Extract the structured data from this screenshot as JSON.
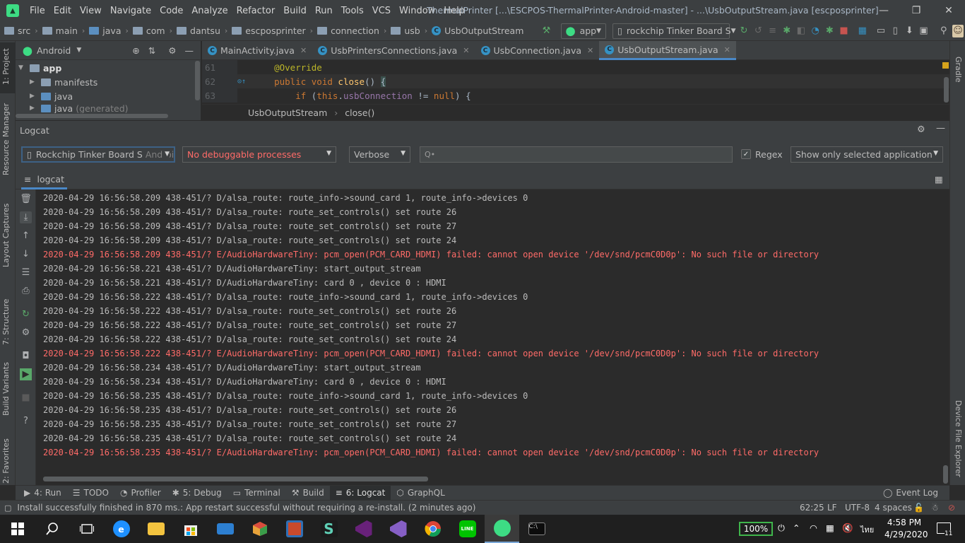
{
  "window": {
    "title": "ThermalPrinter [...\\ESCPOS-ThermalPrinter-Android-master] - ...\\UsbOutputStream.java [escposprinter]",
    "menu": [
      "File",
      "Edit",
      "View",
      "Navigate",
      "Code",
      "Analyze",
      "Refactor",
      "Build",
      "Run",
      "Tools",
      "VCS",
      "Window",
      "Help"
    ]
  },
  "navbar": {
    "breadcrumbs": [
      "src",
      "main",
      "java",
      "com",
      "dantsu",
      "escposprinter",
      "connection",
      "usb",
      "UsbOutputStream"
    ],
    "run_config": "app",
    "device": "rockchip Tinker Board S"
  },
  "left_strip": [
    "1: Project",
    "Resource Manager",
    "Layout Captures",
    "7: Structure",
    "Build Variants",
    "2: Favorites"
  ],
  "right_strip": [
    "Gradle",
    "Device File Explorer"
  ],
  "project": {
    "view_mode": "Android",
    "tree": [
      {
        "label": "app",
        "level": 0,
        "expanded": true
      },
      {
        "label": "manifests",
        "level": 1,
        "expanded": false
      },
      {
        "label": "java",
        "level": 1,
        "expanded": false
      },
      {
        "label": "java",
        "suffix": "(generated)",
        "level": 1,
        "expanded": false
      }
    ]
  },
  "editor": {
    "tabs": [
      {
        "label": "MainActivity.java",
        "active": false
      },
      {
        "label": "UsbPrintersConnections.java",
        "active": false
      },
      {
        "label": "UsbConnection.java",
        "active": false
      },
      {
        "label": "UsbOutputStream.java",
        "active": true
      }
    ],
    "lines": [
      {
        "num": "61",
        "code": "    @Override"
      },
      {
        "num": "62",
        "code": "    public void close() {"
      },
      {
        "num": "63",
        "code": "        if (this.usbConnection != null) {"
      }
    ],
    "crumbs": [
      "UsbOutputStream",
      "close()"
    ]
  },
  "logcat": {
    "title": "Logcat",
    "device": "Rockchip Tinker Board S",
    "device_suffix": "Android",
    "process": "No debuggable processes",
    "level": "Verbose",
    "search_placeholder": "Q•",
    "regex_label": "Regex",
    "regex_checked": true,
    "filter": "Show only selected application",
    "tab_label": "logcat",
    "lines": [
      {
        "text": "2020-04-29 16:56:58.209 438-451/? D/alsa_route: route_info->sound_card 1, route_info->devices 0",
        "level": "D"
      },
      {
        "text": "2020-04-29 16:56:58.209 438-451/? D/alsa_route: route_set_controls() set route 26",
        "level": "D"
      },
      {
        "text": "2020-04-29 16:56:58.209 438-451/? D/alsa_route: route_set_controls() set route 27",
        "level": "D"
      },
      {
        "text": "2020-04-29 16:56:58.209 438-451/? D/alsa_route: route_set_controls() set route 24",
        "level": "D"
      },
      {
        "text": "2020-04-29 16:56:58.209 438-451/? E/AudioHardwareTiny: pcm_open(PCM_CARD_HDMI) failed: cannot open device '/dev/snd/pcmC0D0p': No such file or directory",
        "level": "E"
      },
      {
        "text": "2020-04-29 16:56:58.221 438-451/? D/AudioHardwareTiny: start_output_stream",
        "level": "D"
      },
      {
        "text": "2020-04-29 16:56:58.221 438-451/? D/AudioHardwareTiny: card 0 , device 0 : HDMI",
        "level": "D"
      },
      {
        "text": "2020-04-29 16:56:58.222 438-451/? D/alsa_route: route_info->sound_card 1, route_info->devices 0",
        "level": "D"
      },
      {
        "text": "2020-04-29 16:56:58.222 438-451/? D/alsa_route: route_set_controls() set route 26",
        "level": "D"
      },
      {
        "text": "2020-04-29 16:56:58.222 438-451/? D/alsa_route: route_set_controls() set route 27",
        "level": "D"
      },
      {
        "text": "2020-04-29 16:56:58.222 438-451/? D/alsa_route: route_set_controls() set route 24",
        "level": "D"
      },
      {
        "text": "2020-04-29 16:56:58.222 438-451/? E/AudioHardwareTiny: pcm_open(PCM_CARD_HDMI) failed: cannot open device '/dev/snd/pcmC0D0p': No such file or directory",
        "level": "E"
      },
      {
        "text": "2020-04-29 16:56:58.234 438-451/? D/AudioHardwareTiny: start_output_stream",
        "level": "D"
      },
      {
        "text": "2020-04-29 16:56:58.234 438-451/? D/AudioHardwareTiny: card 0 , device 0 : HDMI",
        "level": "D"
      },
      {
        "text": "2020-04-29 16:56:58.235 438-451/? D/alsa_route: route_info->sound_card 1, route_info->devices 0",
        "level": "D"
      },
      {
        "text": "2020-04-29 16:56:58.235 438-451/? D/alsa_route: route_set_controls() set route 26",
        "level": "D"
      },
      {
        "text": "2020-04-29 16:56:58.235 438-451/? D/alsa_route: route_set_controls() set route 27",
        "level": "D"
      },
      {
        "text": "2020-04-29 16:56:58.235 438-451/? D/alsa_route: route_set_controls() set route 24",
        "level": "D"
      },
      {
        "text": "2020-04-29 16:56:58.235 438-451/? E/AudioHardwareTiny: pcm_open(PCM_CARD_HDMI) failed: cannot open device '/dev/snd/pcmC0D0p': No such file or directory",
        "level": "E"
      }
    ]
  },
  "tool_windows": [
    {
      "label": "4: Run",
      "icon": "play-icon",
      "active": false
    },
    {
      "label": "TODO",
      "icon": "list-icon",
      "active": false
    },
    {
      "label": "Profiler",
      "icon": "gauge-icon",
      "active": false
    },
    {
      "label": "5: Debug",
      "icon": "bug-icon",
      "active": false
    },
    {
      "label": "Terminal",
      "icon": "terminal-icon",
      "active": false
    },
    {
      "label": "Build",
      "icon": "hammer-icon",
      "active": false
    },
    {
      "label": "6: Logcat",
      "icon": "logcat-icon",
      "active": true
    },
    {
      "label": "GraphQL",
      "icon": "graphql-icon",
      "active": false
    }
  ],
  "event_log": "Event Log",
  "status": {
    "message": "Install successfully finished in 870 ms.: App restart successful without requiring a re-install. (2 minutes ago)",
    "position": "62:25",
    "line_sep": "LF",
    "encoding": "UTF-8",
    "indent": "4 spaces"
  },
  "taskbar": {
    "battery": "100%",
    "lang": "ไทย",
    "time": "4:58 PM",
    "date": "4/29/2020",
    "notifications": "11",
    "apps": [
      "start-icon",
      "search-icon",
      "task-view-icon",
      "edge-icon",
      "file-explorer-icon",
      "store-icon",
      "mail-icon",
      "rubik-icon",
      "filezilla-icon",
      "s-app-icon",
      "visual-studio-icon",
      "visual-studio-2-icon",
      "chrome-icon",
      "line-icon",
      "android-studio-icon",
      "cmd-icon"
    ]
  },
  "colors": {
    "accent": "#4a88c7",
    "error": "#ff6b68",
    "android_green": "#3ddc84"
  }
}
